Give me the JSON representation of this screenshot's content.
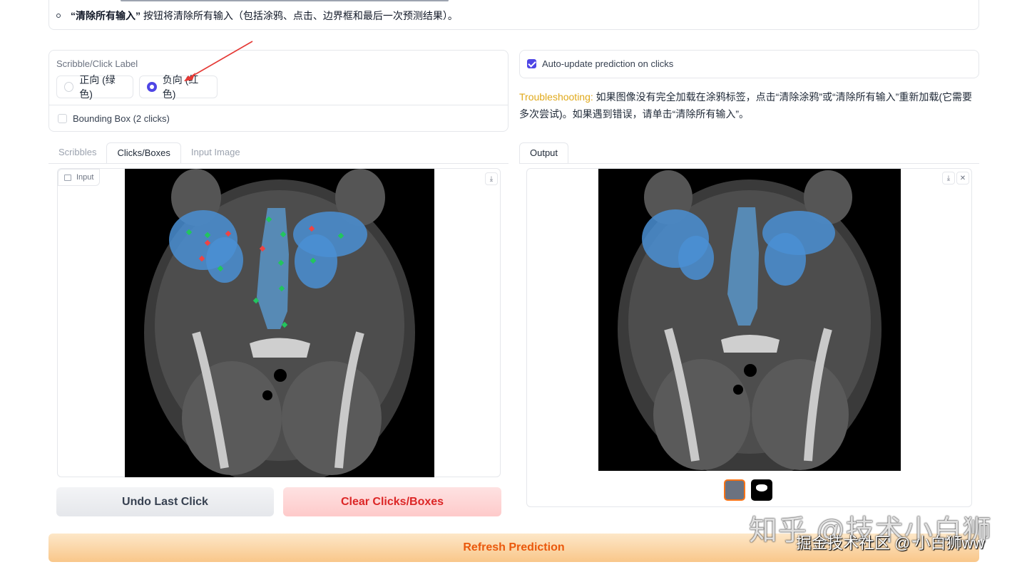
{
  "instructions": {
    "bullet_bold": "“清除所有输入”",
    "bullet_text": " 按钮将清除所有输入（包括涂鸦、点击、边界框和最后一次预测结果）。"
  },
  "label_panel": {
    "title": "Scribble/Click Label",
    "options": [
      "正向 (绿色)",
      "负向 (红色)"
    ],
    "selected": "负向 (红色)",
    "bbox_label": "Bounding Box (2 clicks)"
  },
  "auto_update": {
    "label": "Auto-update prediction on clicks",
    "checked": true
  },
  "troubleshooting": {
    "tag": "Troubleshooting:",
    "text": " 如果图像没有完全加载在涂鸦标签，点击“清除涂鸦”或“清除所有输入”重新加载(它需要多次尝试)。如果遇到错误，请单击“清除所有输入”。"
  },
  "tabs": [
    "Scribbles",
    "Clicks/Boxes",
    "Input Image"
  ],
  "active_tab": "Clicks/Boxes",
  "input_badge": "Input",
  "output_tab": "Output",
  "buttons": {
    "undo": "Undo Last Click",
    "clear": "Clear Clicks/Boxes",
    "refresh": "Refresh Prediction"
  },
  "watermark": {
    "line1": "知乎 @技术小白狮",
    "line2": "掘金技术社区 @ 小白狮ww"
  },
  "colors": {
    "accent": "#4f46e5",
    "positive_click": "#22c55e",
    "negative_click": "#ef4444",
    "mask": "#4a8fd4",
    "troubleshoot": "#e0a91b",
    "clear_text": "#dc2626",
    "refresh_text": "#ea580c"
  }
}
